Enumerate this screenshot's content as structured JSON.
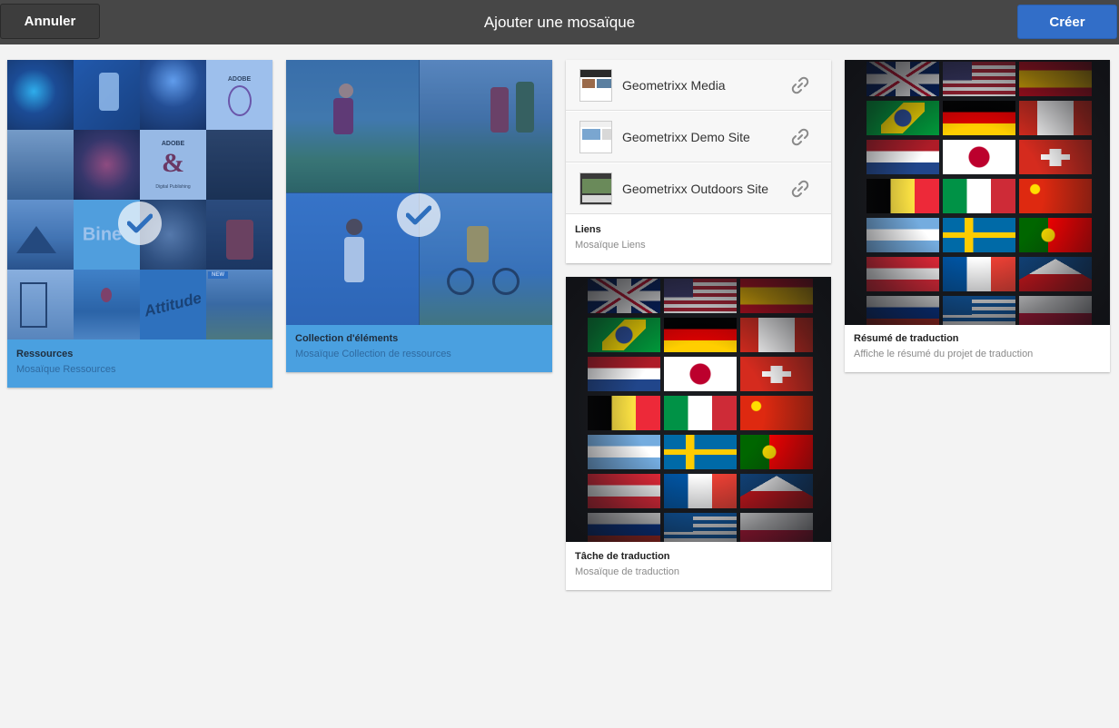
{
  "header": {
    "cancel_label": "Annuler",
    "title": "Ajouter une mosaïque",
    "create_label": "Créer"
  },
  "colors": {
    "header_bg": "#474747",
    "primary_button": "#326ec8",
    "selected_card": "#4aa0e0",
    "page_bg": "#f3f3f3"
  },
  "cards": {
    "resources": {
      "title": "Ressources",
      "subtitle": "Mosaïque Ressources",
      "selected": true,
      "tiles": {
        "adobe": "ADOBE",
        "amp": "&",
        "digital": "Digital Publishing",
        "bine": "Bine",
        "attitude": "Attitude",
        "new": "NEW"
      }
    },
    "collection": {
      "title": "Collection d'éléments",
      "subtitle": "Mosaïque Collection de ressources",
      "selected": true
    },
    "links": {
      "title": "Liens",
      "subtitle": "Mosaïque Liens",
      "items": [
        {
          "name": "Geometrixx Media",
          "icon": "link-icon"
        },
        {
          "name": "Geometrixx Demo Site",
          "icon": "link-icon"
        },
        {
          "name": "Geometrixx Outdoors Site",
          "icon": "link-icon"
        }
      ]
    },
    "translation_summary": {
      "title": "Résumé de traduction",
      "subtitle": "Affiche le résumé du projet de traduction"
    },
    "translation_task": {
      "title": "Tâche de traduction",
      "subtitle": "Mosaïque de traduction"
    }
  }
}
